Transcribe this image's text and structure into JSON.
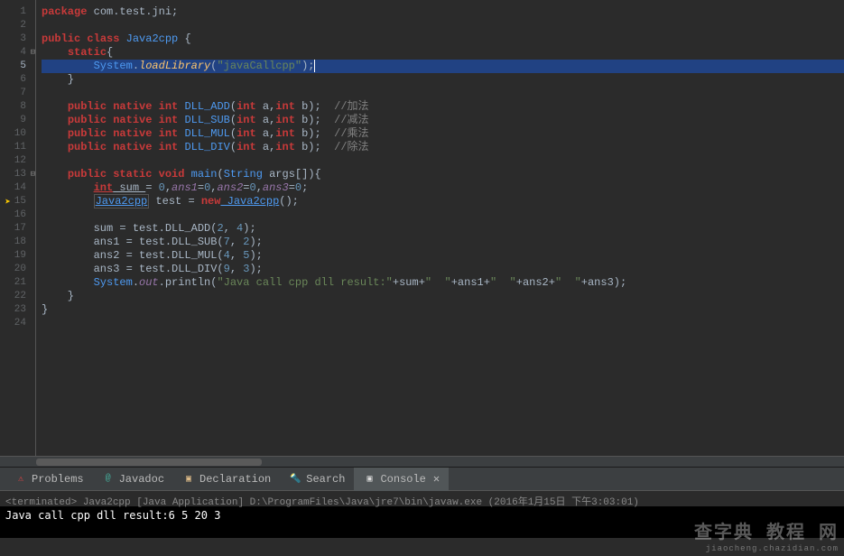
{
  "gutter": {
    "lines": [
      "1",
      "2",
      "3",
      "4",
      "5",
      "6",
      "7",
      "8",
      "9",
      "10",
      "11",
      "12",
      "13",
      "14",
      "15",
      "16",
      "17",
      "18",
      "19",
      "20",
      "21",
      "22",
      "23",
      "24"
    ],
    "fold_lines": [
      4,
      13
    ],
    "breakpoint_line": 15,
    "highlighted_line": 5
  },
  "code": {
    "l1": {
      "kw": "package",
      "pkg": " com.test.jni;"
    },
    "l3": {
      "kw1": "public",
      "kw2": "class",
      "cls": " Java2cpp ",
      "brace": "{"
    },
    "l4": {
      "kw": "static",
      "brace": "{"
    },
    "l5": {
      "sys": "System",
      "dot": ".",
      "method": "loadLibrary",
      "paren": "(",
      "str": "\"javaCallcpp\"",
      "end": ");"
    },
    "l6": {
      "brace": "    }"
    },
    "l8": {
      "kw1": "public",
      "kw2": "native",
      "type": "int",
      "method": " DLL_ADD",
      "paren": "(",
      "t1": "int",
      "a1": " a,",
      "t2": "int",
      "a2": " b);",
      "comment": "  //加法"
    },
    "l9": {
      "kw1": "public",
      "kw2": "native",
      "type": "int",
      "method": " DLL_SUB",
      "paren": "(",
      "t1": "int",
      "a1": " a,",
      "t2": "int",
      "a2": " b);",
      "comment": "  //减法"
    },
    "l10": {
      "kw1": "public",
      "kw2": "native",
      "type": "int",
      "method": " DLL_MUL",
      "paren": "(",
      "t1": "int",
      "a1": " a,",
      "t2": "int",
      "a2": " b);",
      "comment": "  //乘法"
    },
    "l11": {
      "kw1": "public",
      "kw2": "native",
      "type": "int",
      "method": " DLL_DIV",
      "paren": "(",
      "t1": "int",
      "a1": " a,",
      "t2": "int",
      "a2": " b);",
      "comment": "  //除法"
    },
    "l13": {
      "kw1": "public",
      "kw2": "static",
      "type": "void",
      "method": " main",
      "paren": "(",
      "t1": "String",
      "a1": " args[]){"
    },
    "l14": {
      "type": "int",
      "v1": " sum ",
      "eq": "= ",
      "n1": "0",
      "c1": ",",
      "v2": "ans1",
      "eq2": "=",
      "n2": "0",
      "c2": ",",
      "v3": "ans2",
      "eq3": "=",
      "n3": "0",
      "c3": ",",
      "v4": "ans3",
      "eq4": "=",
      "n4": "0",
      "end": ";"
    },
    "l15": {
      "cls1": "Java2cpp",
      "v": " test ",
      "eq": "= ",
      "kw": "new",
      "cls2": " Java2cpp",
      "end": "();"
    },
    "l17": {
      "v": "sum = test.DLL_ADD(",
      "n1": "2",
      "c": ", ",
      "n2": "4",
      "end": ");"
    },
    "l18": {
      "v": "ans1 = test.DLL_SUB(",
      "n1": "7",
      "c": ", ",
      "n2": "2",
      "end": ");"
    },
    "l19": {
      "v": "ans2 = test.DLL_MUL(",
      "n1": "4",
      "c": ", ",
      "n2": "5",
      "end": ");"
    },
    "l20": {
      "v": "ans3 = test.DLL_DIV(",
      "n1": "9",
      "c": ", ",
      "n2": "3",
      "end": ");"
    },
    "l21": {
      "sys": "System",
      "dot": ".",
      "out": "out",
      "dot2": ".",
      "m": "println(",
      "str": "\"Java call cpp dll result:\"",
      "p1": "+sum+",
      "str2": "\"  \"",
      "p2": "+ans1+",
      "str3": "\"  \"",
      "p3": "+ans2+",
      "str4": "\"  \"",
      "p4": "+ans3);"
    },
    "l22": {
      "brace": "    }"
    },
    "l23": {
      "brace": "}"
    }
  },
  "tabs": {
    "0": {
      "label": "Problems",
      "icon_color": "#d44"
    },
    "1": {
      "label": "Javadoc",
      "icon_color": "#4a9"
    },
    "2": {
      "label": "Declaration",
      "icon_color": "#db8"
    },
    "3": {
      "label": "Search",
      "icon_color": "#5af"
    },
    "4": {
      "label": "Console",
      "icon_color": "#ddd",
      "active": true
    }
  },
  "console": {
    "header": "<terminated> Java2cpp [Java Application] D:\\ProgramFiles\\Java\\jre7\\bin\\javaw.exe (2016年1月15日 下午3:03:01)",
    "output": "Java call cpp dll result:6  5  20  3"
  },
  "watermark": {
    "cn": "查字典 教程 网",
    "url": "jiaocheng.chazidian.com"
  }
}
